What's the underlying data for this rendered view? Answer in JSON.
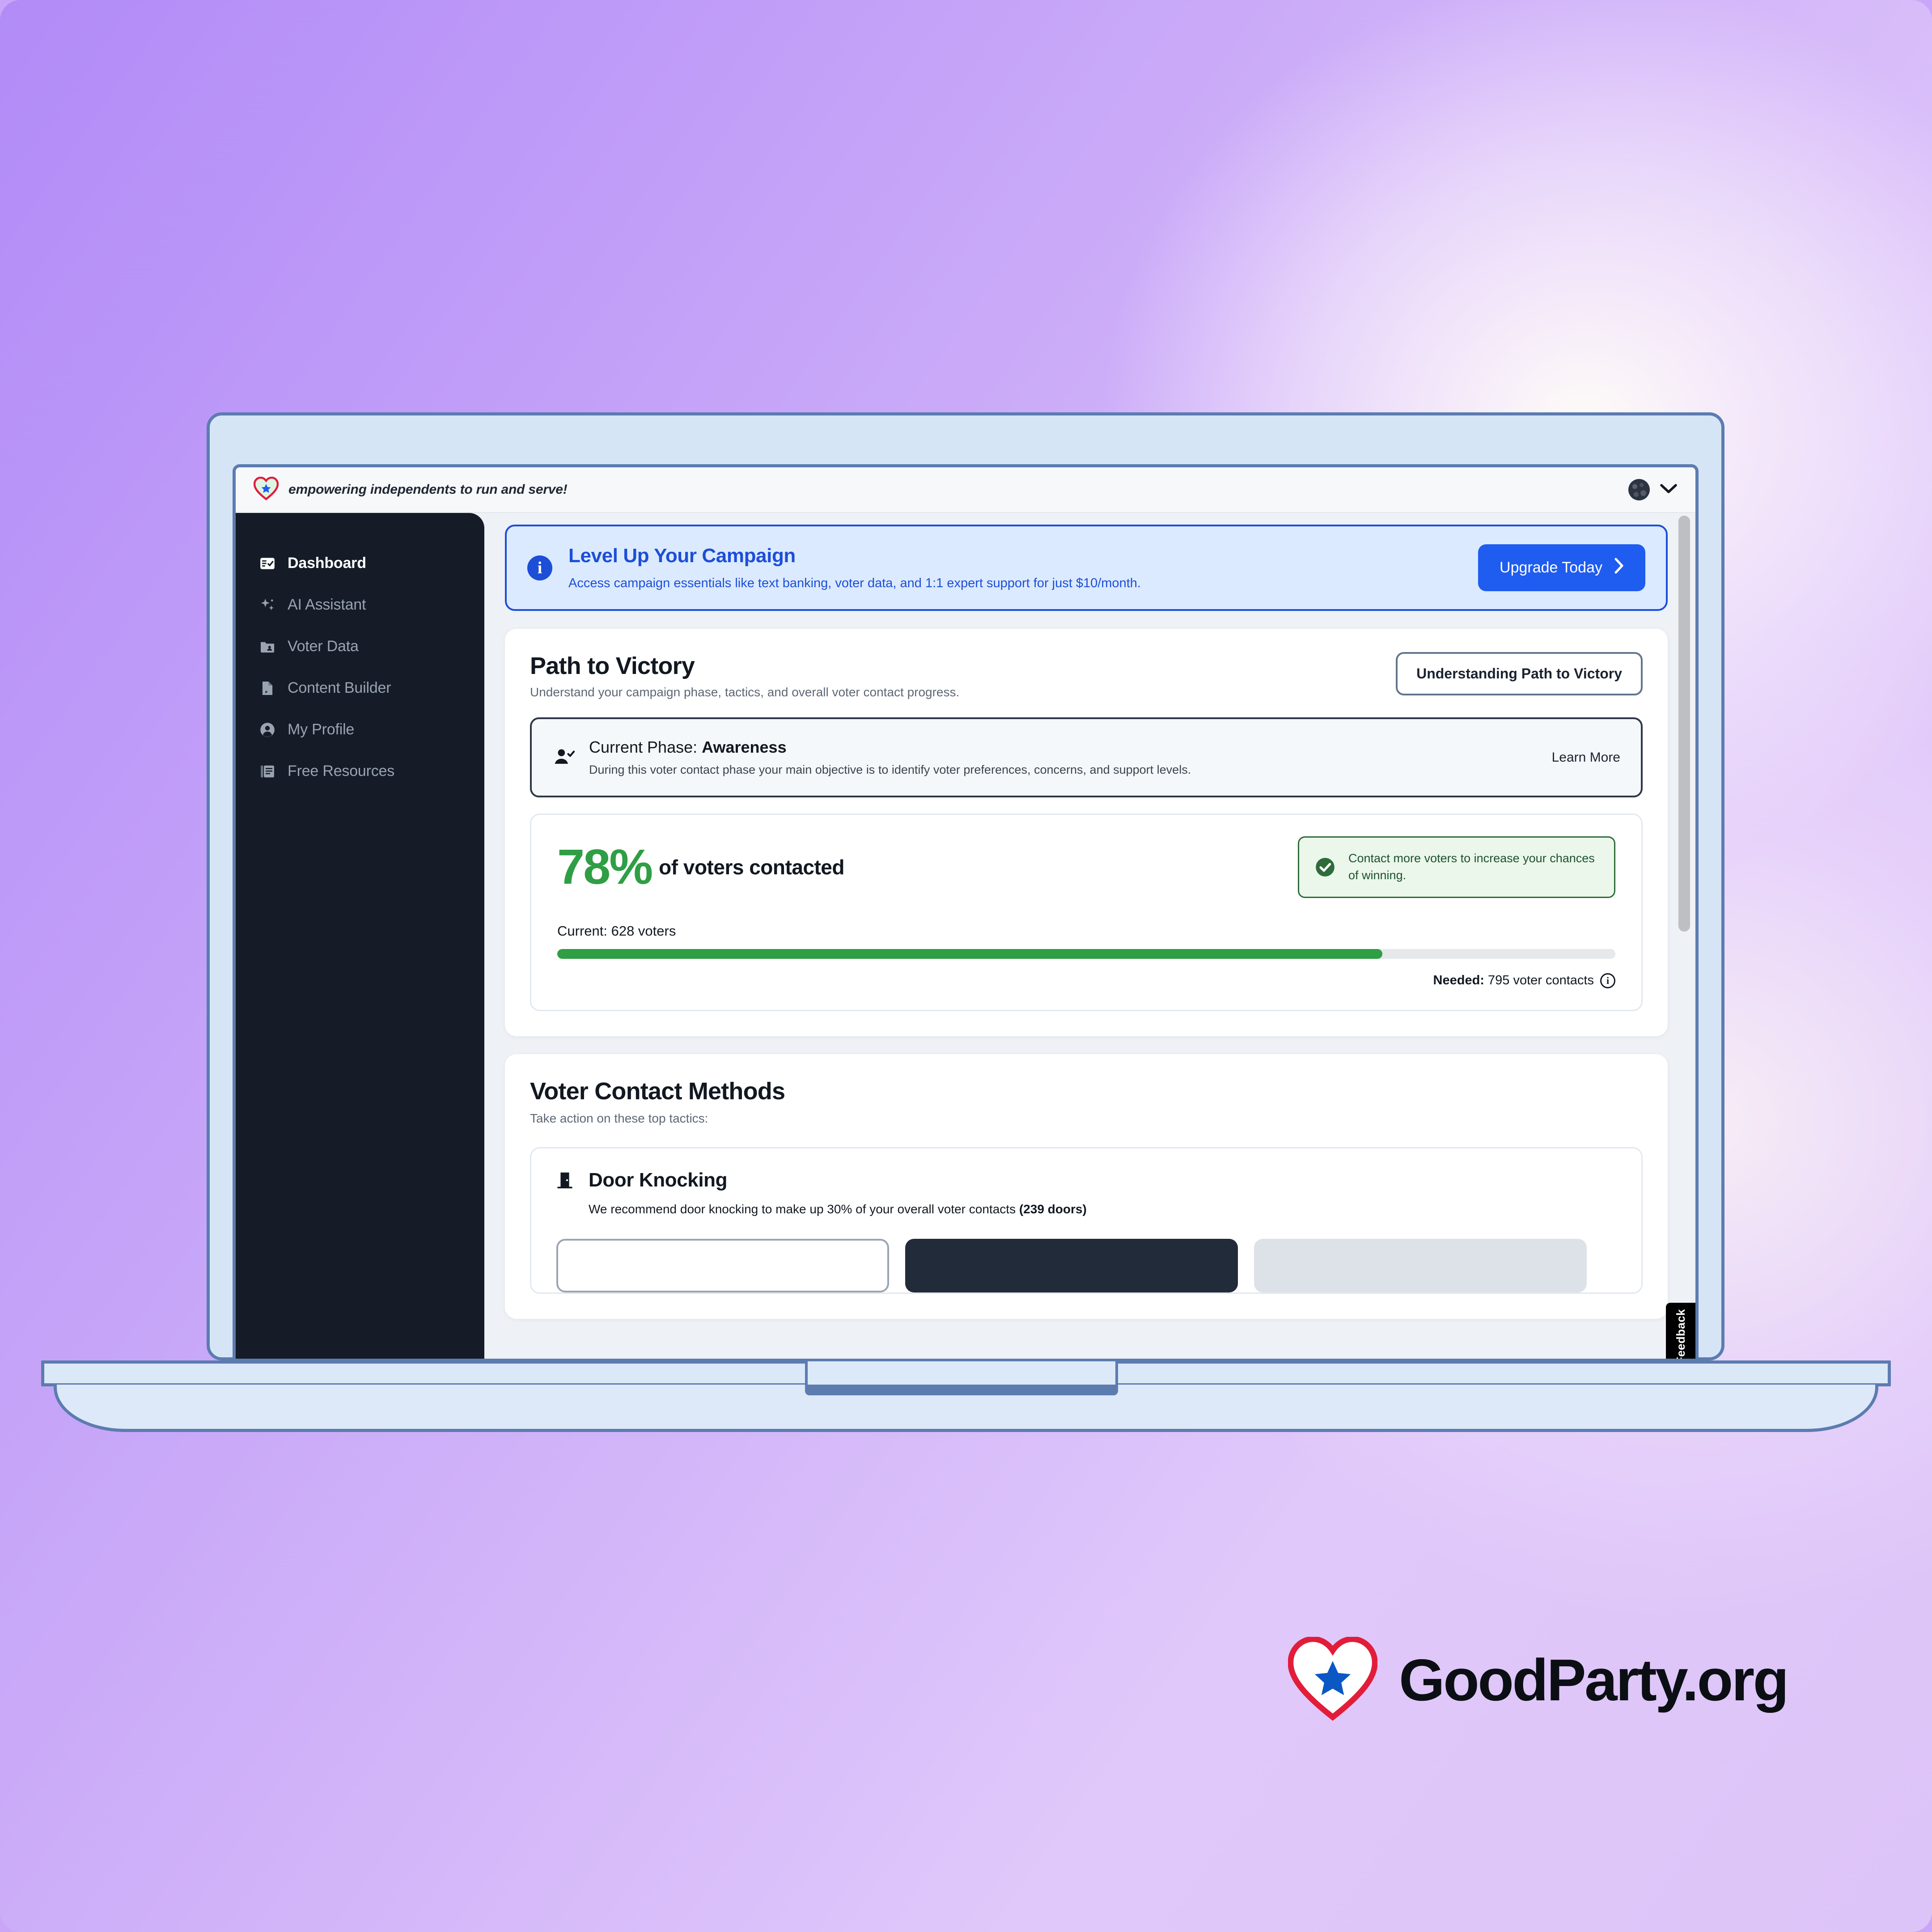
{
  "brand": {
    "name": "GoodParty.org",
    "heart_icon": "heart-star-logo",
    "accent_red": "#e11d3a",
    "accent_blue": "#0b57c4"
  },
  "app": {
    "header": {
      "logo_icon": "goodparty-heart-icon",
      "tagline": "empowering independents to run and serve!",
      "avatar_icon": "user-avatar",
      "chevron_icon": "chevron-down-icon"
    },
    "sidebar": {
      "items": [
        {
          "label": "Dashboard",
          "icon": "dashboard-icon",
          "active": true
        },
        {
          "label": "AI Assistant",
          "icon": "sparkle-icon",
          "active": false
        },
        {
          "label": "Voter Data",
          "icon": "folder-user-icon",
          "active": false
        },
        {
          "label": "Content Builder",
          "icon": "document-edit-icon",
          "active": false
        },
        {
          "label": "My Profile",
          "icon": "person-circle-icon",
          "active": false
        },
        {
          "label": "Free Resources",
          "icon": "book-icon",
          "active": false
        }
      ]
    },
    "banner": {
      "icon": "info-icon",
      "badge": "i",
      "title": "Level Up Your Campaign",
      "subtitle": "Access campaign essentials like text banking, voter data, and 1:1 expert support for just $10/month.",
      "cta_label": "Upgrade Today",
      "cta_arrow": "chevron-right-icon",
      "accent": "#1d4ed8"
    },
    "path_to_victory": {
      "title": "Path to Victory",
      "subtitle": "Understand your campaign phase, tactics, and overall voter contact progress.",
      "help_button": "Understanding Path to Victory",
      "phase": {
        "icon": "person-check-icon",
        "label": "Current Phase:",
        "value": "Awareness",
        "description": "During this voter contact phase your main objective is to identify voter preferences, concerns, and support levels.",
        "learn_more": "Learn More"
      },
      "progress": {
        "percent_text": "78%",
        "percent_value": 78,
        "percent_label": "of voters contacted",
        "current_text": "Current: 628 voters",
        "current_value": 628,
        "needed_prefix": "Needed:",
        "needed_text": "795 voter contacts",
        "needed_value": 795,
        "info_icon": "info-outline-icon",
        "bar_color": "#2f9e44",
        "tip": {
          "icon": "check-circle-icon",
          "text": "Contact more voters to increase your chances of winning.",
          "bg": "#eaf7ea",
          "border": "#2f6b3a"
        }
      }
    },
    "voter_contact_methods": {
      "title": "Voter Contact Methods",
      "subtitle": "Take action on these top tactics:",
      "tactics": [
        {
          "icon": "door-icon",
          "name": "Door Knocking",
          "description_prefix": "We recommend door knocking to make up 30% of your overall voter contacts ",
          "description_bold": "(239 doors)",
          "actions": [
            {
              "style": "outline"
            },
            {
              "style": "filled-dark"
            },
            {
              "style": "muted"
            }
          ]
        }
      ]
    },
    "feedback_tab": {
      "label": "Feedback",
      "icon": "star-outline-icon"
    },
    "scrollbar": {
      "present": true
    }
  }
}
